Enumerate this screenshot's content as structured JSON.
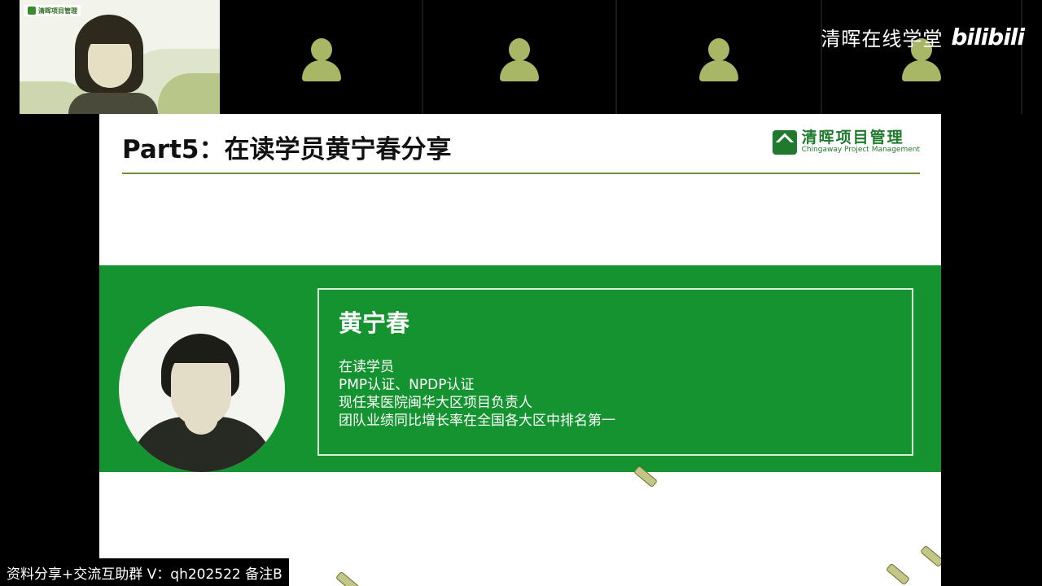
{
  "participants": {
    "host": {
      "logo_text": "清晖项目管理"
    },
    "tiles": [
      {
        "icon": "person-placeholder-icon"
      },
      {
        "icon": "person-placeholder-icon"
      },
      {
        "icon": "person-placeholder-icon"
      },
      {
        "icon": "person-placeholder-icon"
      }
    ]
  },
  "watermark": {
    "text": "清晖在线学堂",
    "brand": "bilibili"
  },
  "slide": {
    "title": "Part5：在读学员黄宁春分享",
    "logo": {
      "cn": "清晖项目管理",
      "en": "Chingaway Project Management"
    },
    "profile": {
      "name": "黄宁春",
      "lines": [
        "在读学员",
        "PMP认证、NPDP认证",
        "现任某医院闽华大区项目负责人",
        "团队业绩同比增长率在全国各大区中排名第一"
      ]
    }
  },
  "banner": {
    "text": "资料分享+交流互助群 V：qh202522 备注B"
  },
  "colors": {
    "band_green": "#159330",
    "accent_green": "#1f7a2d",
    "placeholder": "#a8b765"
  }
}
